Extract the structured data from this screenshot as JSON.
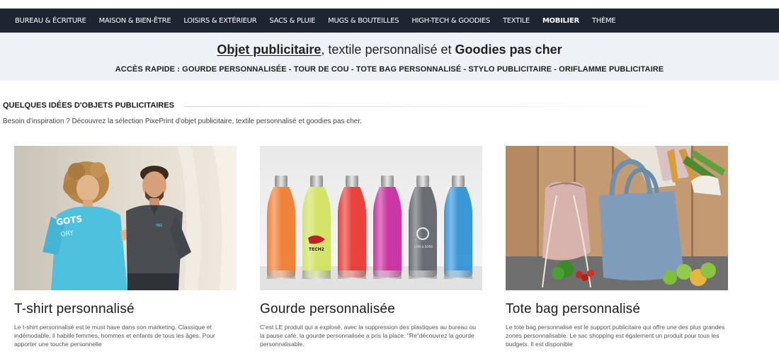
{
  "nav": {
    "items": [
      {
        "label": "BUREAU & ÉCRITURE"
      },
      {
        "label": "MAISON & BIEN-ÊTRE"
      },
      {
        "label": "LOISIRS & EXTÉRIEUR"
      },
      {
        "label": "SACS & PLUIE"
      },
      {
        "label": "MUGS & BOUTEILLES"
      },
      {
        "label": "HIGH-TECH & GOODIES"
      },
      {
        "label": "TEXTILE"
      },
      {
        "label": "MOBILIER"
      },
      {
        "label": "THÈME"
      }
    ],
    "active_label": "MOBILIER"
  },
  "hero": {
    "title_link": "Objet publicitaire",
    "title_mid": ", textile personnalisé et ",
    "title_strong": "Goodies pas cher",
    "quick_prefix": "ACCÈS RAPIDE : ",
    "quick_links": [
      "GOURDE PERSONNALISÉE",
      "TOUR DE COU",
      "TOTE BAG PERSONNALISÉ",
      "STYLO PUBLICITAIRE",
      "ORIFLAMME PUBLICITAIRE"
    ],
    "quick_separator": " - "
  },
  "section": {
    "title": "QUELQUES IDÉES D'OBJETS PUBLICITAIRES",
    "intro": "Besoin d'inspiration ? Découvrez la sélection PixePrint d'objet publicitaire, textile personnalisé et goodies pas cher."
  },
  "cards": [
    {
      "title": "T-shirt personnalisé",
      "text": "Le t-shirt personnalisé est le must have dans son marketing. Classique et indémodable, il habille femmes, hommes et enfants de tous les âges. Pour apporter une touche personnelle",
      "shirt_print": "GOTS",
      "shirt_print2": "ORY",
      "shirt_print3": "ING"
    },
    {
      "title": "Gourde personnalisée",
      "text": "C'est LE produit qui a explosé, avec la suppression des plastiques au bureau ou la pause café, la gourde personnalisée a pris la place. \"Re\"découvrez la gourde personnalisable.",
      "bottle_logo_1": "TECH2",
      "bottle_logo_2": "LAIN & SONS"
    },
    {
      "title": "Tote bag personnalisé",
      "text": "Le tote bag personnalisé est le support publicitaire qui offre une des plus grandes zones personnalisable. Le sac shopping est également un produit pour tous les budgets. Il est disponible"
    }
  ],
  "colors": {
    "navbar_bg": "#1d2533",
    "hero_bg": "#eef1f5",
    "bottles": [
      "#f07a2a",
      "#cfe25a",
      "#e8322c",
      "#c8239a",
      "#5a5f66",
      "#2a8fd6"
    ]
  }
}
